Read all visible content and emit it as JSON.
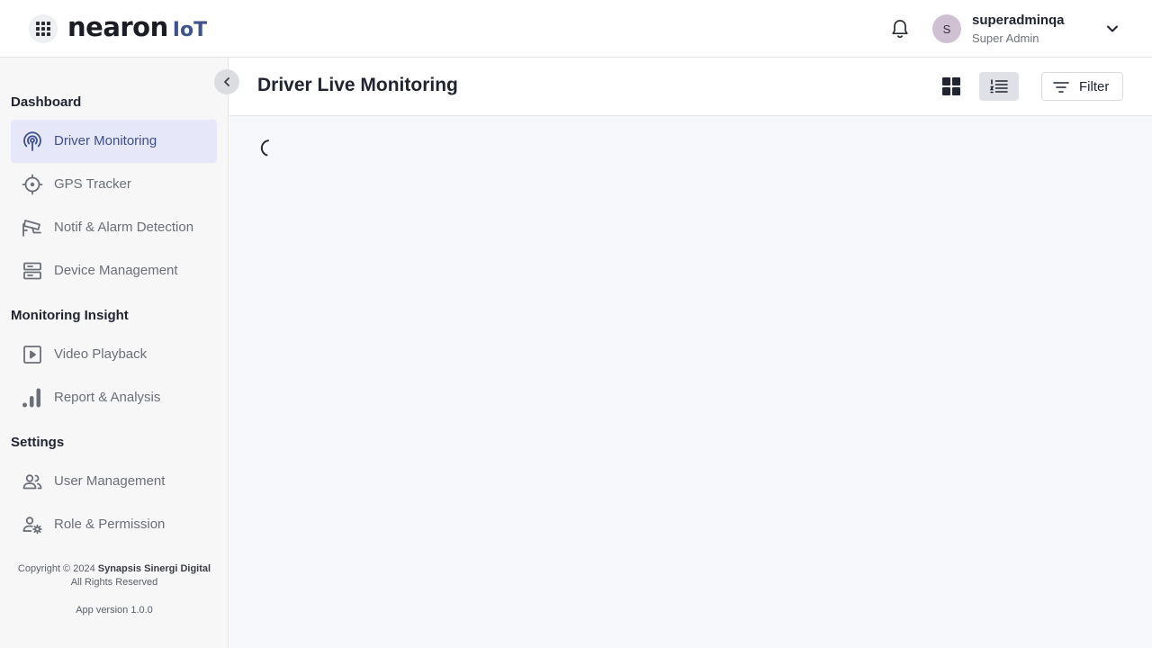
{
  "header": {
    "logo_main": "nearon",
    "logo_sub": "IoT",
    "user_initial": "S",
    "user_name": "superadminqa",
    "user_role": "Super Admin"
  },
  "sidebar": {
    "sections": [
      {
        "title": "Dashboard",
        "items": [
          {
            "label": "Driver Monitoring",
            "icon": "broadcast-icon",
            "active": true
          },
          {
            "label": "GPS Tracker",
            "icon": "crosshair-icon",
            "active": false
          },
          {
            "label": "Notif & Alarm Detection",
            "icon": "cctv-camera-icon",
            "active": false
          },
          {
            "label": "Device Management",
            "icon": "server-icon",
            "active": false
          }
        ]
      },
      {
        "title": "Monitoring Insight",
        "items": [
          {
            "label": "Video Playback",
            "icon": "play-square-icon",
            "active": false
          },
          {
            "label": "Report & Analysis",
            "icon": "bar-chart-icon",
            "active": false
          }
        ]
      },
      {
        "title": "Settings",
        "items": [
          {
            "label": "User Management",
            "icon": "users-icon",
            "active": false
          },
          {
            "label": "Role & Permission",
            "icon": "user-gear-icon",
            "active": false
          }
        ]
      }
    ],
    "footer": {
      "copyright_prefix": "Copyright © 2024",
      "company": "Synapsis Sinergi Digital",
      "rights": "All Rights Reserved",
      "version": "App version 1.0.0"
    }
  },
  "main": {
    "title": "Driver Live Monitoring",
    "view_mode": "list",
    "filter_label": "Filter",
    "loading": true
  },
  "colors": {
    "accent": "#3c4f8f",
    "active_bg": "#e6e8f9",
    "sidebar_bg": "#f7f7f8",
    "content_bg": "#f7f8fc"
  }
}
